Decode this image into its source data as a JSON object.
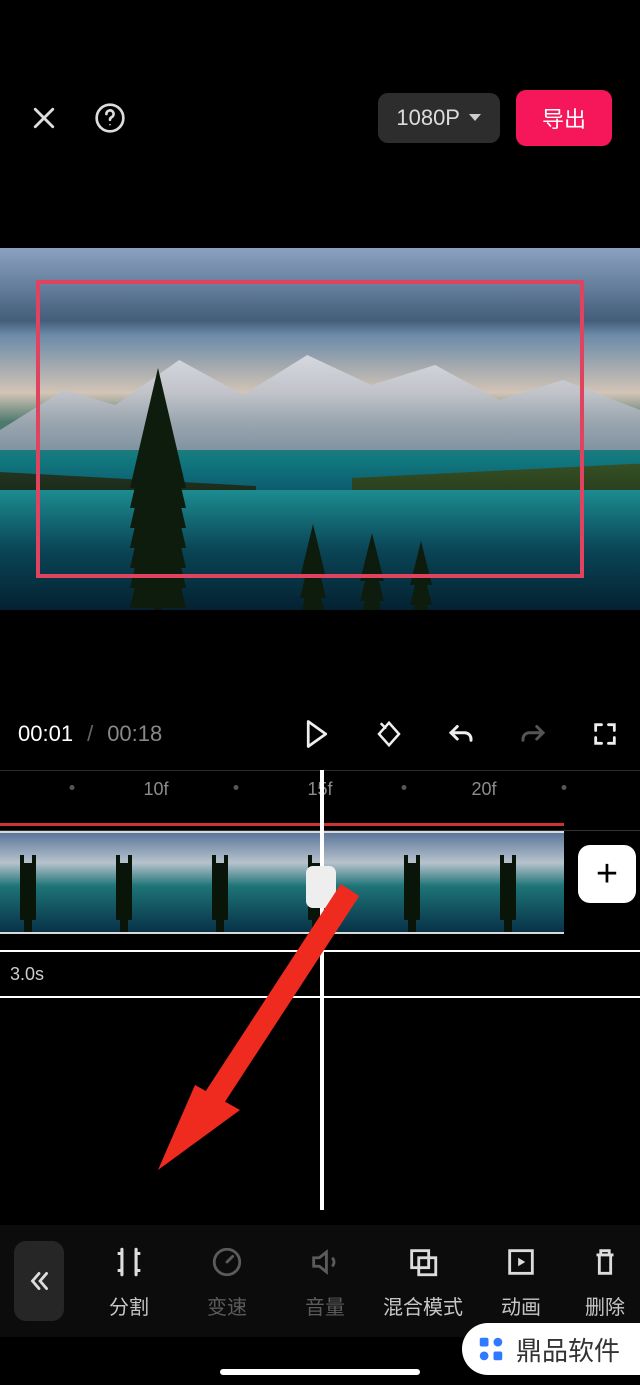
{
  "header": {
    "resolution_label": "1080P",
    "export_label": "导出"
  },
  "playback": {
    "current_time": "00:01",
    "separator": "/",
    "total_time": "00:18"
  },
  "timeline": {
    "ruler_marks": [
      "10f",
      "15f",
      "20f"
    ],
    "subtrack_duration": "3.0s"
  },
  "toolbar": {
    "items": [
      {
        "label": "分割",
        "icon": "split-icon",
        "dim": false
      },
      {
        "label": "变速",
        "icon": "speed-icon",
        "dim": true
      },
      {
        "label": "音量",
        "icon": "volume-icon",
        "dim": true
      },
      {
        "label": "混合模式",
        "icon": "blend-icon",
        "dim": false
      },
      {
        "label": "动画",
        "icon": "motion-icon",
        "dim": false
      },
      {
        "label": "删除",
        "icon": "delete-icon",
        "dim": false
      }
    ]
  },
  "watermark": {
    "text": "鼎品软件"
  },
  "add_button": "+"
}
